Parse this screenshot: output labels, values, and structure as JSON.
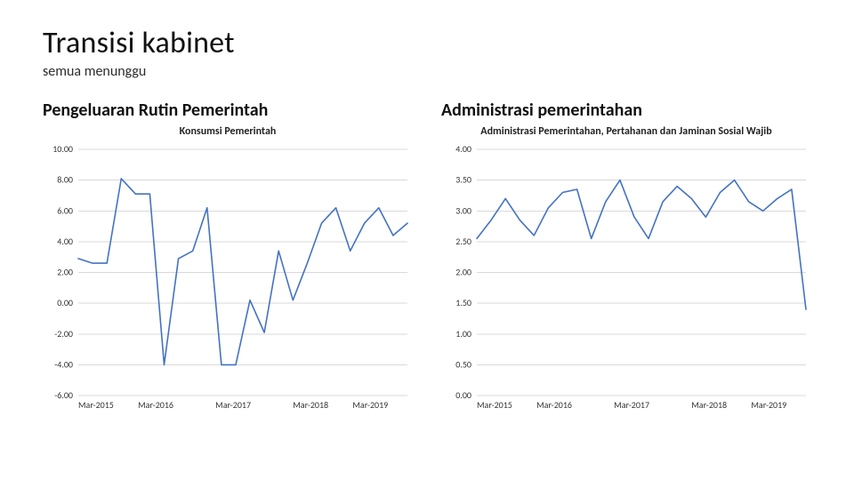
{
  "header": {
    "title": "Transisi kabinet",
    "subtitle": "semua menunggu"
  },
  "left": {
    "section_title": "Pengeluaran Rutin Pemerintah"
  },
  "right": {
    "section_title": "Administrasi pemerintahan"
  },
  "chart_data": [
    {
      "id": "left",
      "type": "line",
      "title": "Konsumsi Pemerintah",
      "xlabel": "",
      "ylabel": "",
      "ylim": [
        -6,
        10
      ],
      "ytick_step": 2,
      "x_categories": [
        "Mar-2015",
        "Mar-2016",
        "Mar-2017",
        "Mar-2018",
        "Mar-2019"
      ],
      "series": [
        {
          "name": "Konsumsi Pemerintah",
          "color": "#4472c4",
          "values": [
            2.9,
            2.6,
            2.6,
            8.1,
            7.1,
            7.1,
            -4.0,
            2.9,
            3.4,
            6.2,
            -4.0,
            -4.0,
            0.2,
            -1.9,
            3.4,
            0.2,
            2.6,
            5.2,
            6.2,
            3.4,
            5.2,
            6.2,
            4.4,
            5.2
          ]
        }
      ]
    },
    {
      "id": "right",
      "type": "line",
      "title": "Administrasi Pemerintahan, Pertahanan dan Jaminan Sosial Wajib",
      "xlabel": "",
      "ylabel": "",
      "ylim": [
        0,
        4
      ],
      "ytick_step": 0.5,
      "x_categories": [
        "Mar-2015",
        "Mar-2016",
        "Mar-2017",
        "Mar-2018",
        "Mar-2019"
      ],
      "series": [
        {
          "name": "Administrasi Pemerintahan",
          "color": "#4472c4",
          "values": [
            2.55,
            2.85,
            3.2,
            2.85,
            2.6,
            3.05,
            3.3,
            3.35,
            2.55,
            3.15,
            3.5,
            2.9,
            2.55,
            3.15,
            3.4,
            3.2,
            2.9,
            3.3,
            3.5,
            3.15,
            3.0,
            3.2,
            3.35,
            1.4
          ]
        }
      ]
    }
  ]
}
